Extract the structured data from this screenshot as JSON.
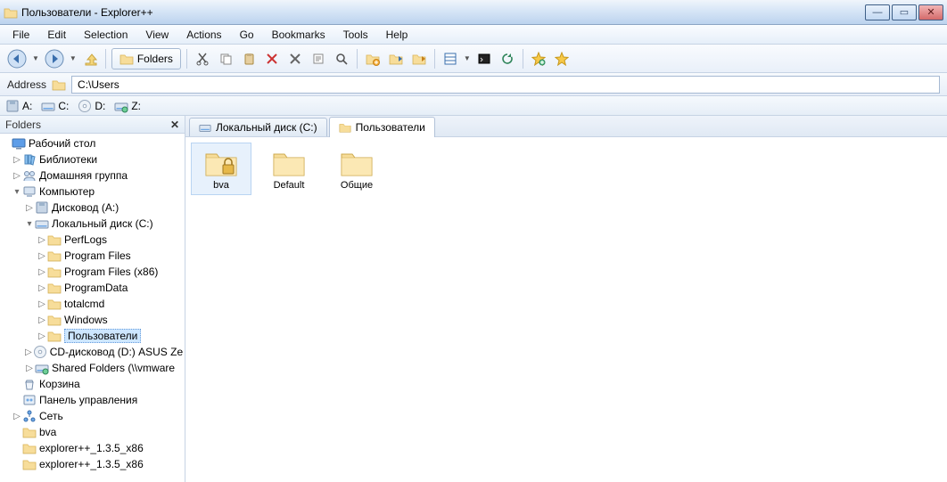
{
  "window": {
    "title": "Пользователи - Explorer++"
  },
  "menu": [
    "File",
    "Edit",
    "Selection",
    "View",
    "Actions",
    "Go",
    "Bookmarks",
    "Tools",
    "Help"
  ],
  "toolbar": {
    "folders_label": "Folders"
  },
  "address": {
    "label": "Address",
    "value": "C:\\Users"
  },
  "drives": [
    {
      "id": "a",
      "label": "A:"
    },
    {
      "id": "c",
      "label": "C:"
    },
    {
      "id": "d",
      "label": "D:"
    },
    {
      "id": "z",
      "label": "Z:"
    }
  ],
  "folders_panel": {
    "title": "Folders"
  },
  "tree": [
    {
      "indent": 0,
      "twisty": "",
      "icon": "desktop",
      "label": "Рабочий стол"
    },
    {
      "indent": 1,
      "twisty": "▷",
      "icon": "libraries",
      "label": "Библиотеки"
    },
    {
      "indent": 1,
      "twisty": "▷",
      "icon": "homegroup",
      "label": "Домашняя группа"
    },
    {
      "indent": 1,
      "twisty": "▾",
      "icon": "computer",
      "label": "Компьютер"
    },
    {
      "indent": 2,
      "twisty": "▷",
      "icon": "floppy",
      "label": "Дисковод (A:)"
    },
    {
      "indent": 2,
      "twisty": "▾",
      "icon": "hdd",
      "label": "Локальный диск (C:)"
    },
    {
      "indent": 3,
      "twisty": "▷",
      "icon": "folder",
      "label": "PerfLogs"
    },
    {
      "indent": 3,
      "twisty": "▷",
      "icon": "folder",
      "label": "Program Files"
    },
    {
      "indent": 3,
      "twisty": "▷",
      "icon": "folder",
      "label": "Program Files (x86)"
    },
    {
      "indent": 3,
      "twisty": "▷",
      "icon": "folder",
      "label": "ProgramData"
    },
    {
      "indent": 3,
      "twisty": "▷",
      "icon": "folder",
      "label": "totalcmd"
    },
    {
      "indent": 3,
      "twisty": "▷",
      "icon": "folder",
      "label": "Windows"
    },
    {
      "indent": 3,
      "twisty": "▷",
      "icon": "folder",
      "label": "Пользователи",
      "selected": true
    },
    {
      "indent": 2,
      "twisty": "▷",
      "icon": "cd",
      "label": "CD-дисковод (D:) ASUS Ze"
    },
    {
      "indent": 2,
      "twisty": "▷",
      "icon": "netdrive",
      "label": "Shared Folders (\\\\vmware"
    },
    {
      "indent": 1,
      "twisty": "",
      "icon": "recycle",
      "label": "Корзина"
    },
    {
      "indent": 1,
      "twisty": "",
      "icon": "cpanel",
      "label": "Панель управления"
    },
    {
      "indent": 1,
      "twisty": "▷",
      "icon": "network",
      "label": "Сеть"
    },
    {
      "indent": 1,
      "twisty": "",
      "icon": "folder",
      "label": "bva"
    },
    {
      "indent": 1,
      "twisty": "",
      "icon": "folder",
      "label": "explorer++_1.3.5_x86"
    },
    {
      "indent": 1,
      "twisty": "",
      "icon": "folder",
      "label": "explorer++_1.3.5_x86"
    }
  ],
  "tabs": [
    {
      "icon": "hdd",
      "label": "Локальный диск (C:)",
      "active": false
    },
    {
      "icon": "folder",
      "label": "Пользователи",
      "active": true
    }
  ],
  "files": [
    {
      "icon": "folder-lock",
      "label": "bva",
      "selected": true
    },
    {
      "icon": "folder",
      "label": "Default",
      "selected": false
    },
    {
      "icon": "folder",
      "label": "Общие",
      "selected": false
    }
  ]
}
